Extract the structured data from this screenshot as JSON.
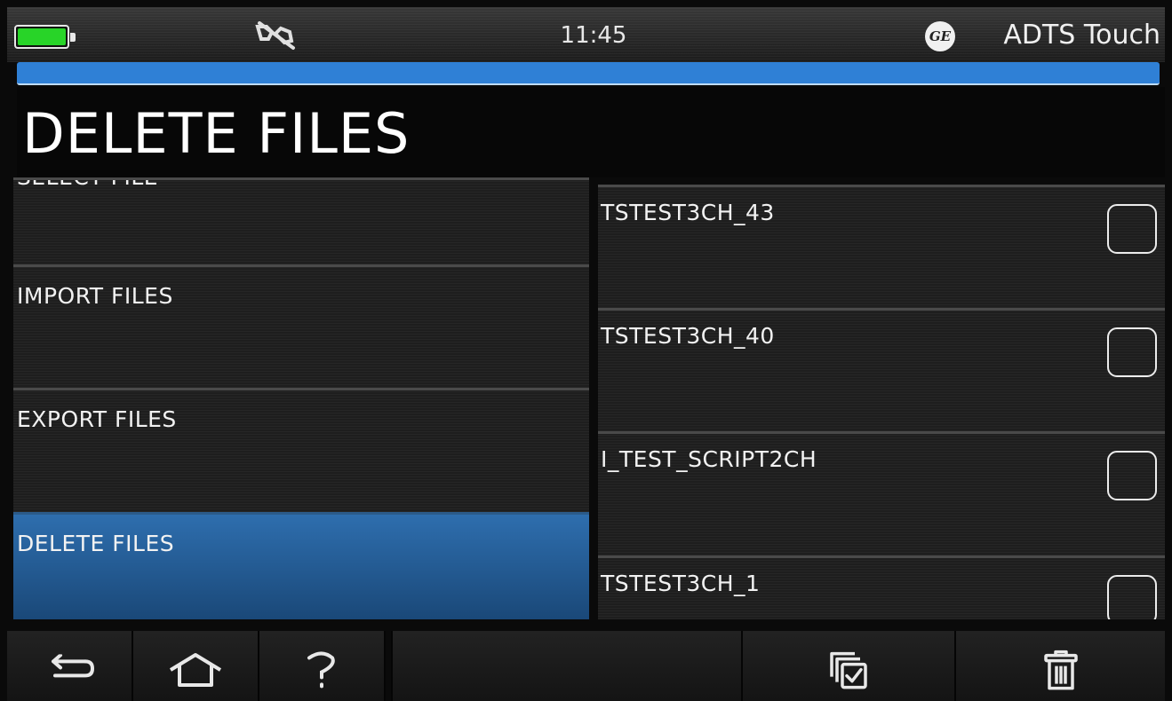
{
  "statusbar": {
    "time": "11:45",
    "app_name": "ADTS Touch",
    "logo_text": "GE",
    "battery_level": 1.0,
    "battery_color": "#28d428",
    "icons": [
      "battery-icon",
      "usb-disconnected-icon",
      "ge-logo-icon"
    ]
  },
  "progress": {
    "color": "#2f80d6",
    "value": 1.0
  },
  "page": {
    "title": "DELETE FILES"
  },
  "menu": {
    "items": [
      {
        "label": "SELECT FILE"
      },
      {
        "label": "IMPORT FILES"
      },
      {
        "label": "EXPORT FILES"
      },
      {
        "label": "DELETE FILES",
        "selected": true
      }
    ],
    "selected_color": "#2e6eae"
  },
  "files": {
    "items": [
      {
        "name": "TSTEST3CH_43",
        "checked": false
      },
      {
        "name": "TSTEST3CH_40",
        "checked": false
      },
      {
        "name": "I_TEST_SCRIPT2CH",
        "checked": false
      },
      {
        "name": "TSTEST3CH_1",
        "checked": false
      }
    ]
  },
  "toolbar": {
    "buttons": [
      "back-icon",
      "home-icon",
      "help-icon",
      "select-all-icon",
      "trash-icon"
    ]
  }
}
